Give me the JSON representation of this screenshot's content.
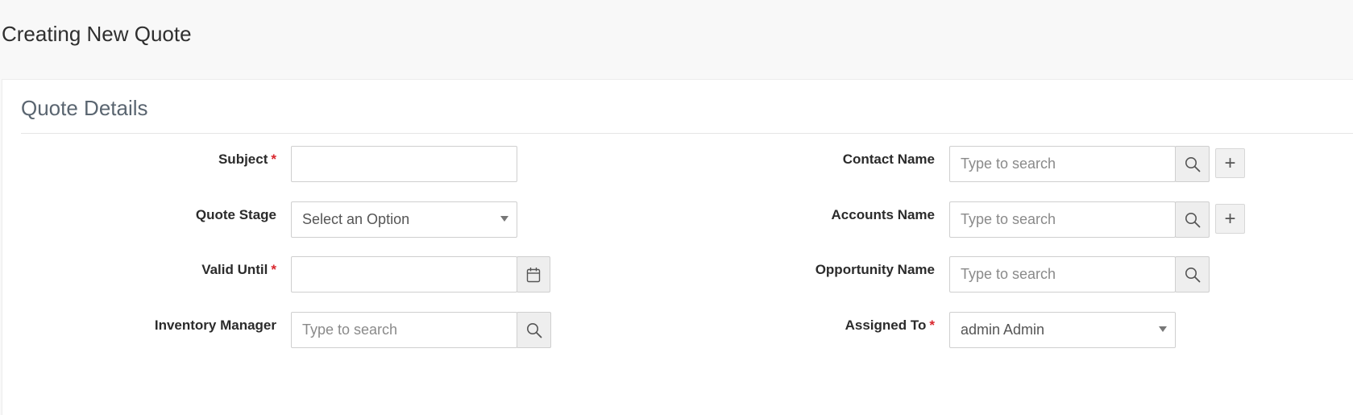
{
  "page": {
    "title": "Creating New Quote"
  },
  "section": {
    "title": "Quote Details"
  },
  "required_marker": "*",
  "left_fields": {
    "subject": {
      "label": "Subject",
      "value": ""
    },
    "quote_stage": {
      "label": "Quote Stage",
      "selected": "Select an Option"
    },
    "valid_until": {
      "label": "Valid Until",
      "value": ""
    },
    "inventory_manager": {
      "label": "Inventory Manager",
      "placeholder": "Type to search"
    }
  },
  "right_fields": {
    "contact_name": {
      "label": "Contact Name",
      "placeholder": "Type to search",
      "add_label": "+"
    },
    "accounts_name": {
      "label": "Accounts Name",
      "placeholder": "Type to search",
      "add_label": "+"
    },
    "opportunity_name": {
      "label": "Opportunity Name",
      "placeholder": "Type to search"
    },
    "assigned_to": {
      "label": "Assigned To",
      "selected": "admin Admin"
    }
  },
  "icons": {
    "search": "search-icon",
    "calendar": "calendar-icon",
    "caret": "chevron-down-icon",
    "plus": "plus-icon"
  },
  "colors": {
    "required": "#d9262d",
    "addon_bg": "#eeeeee",
    "border": "#cfcfcf"
  }
}
